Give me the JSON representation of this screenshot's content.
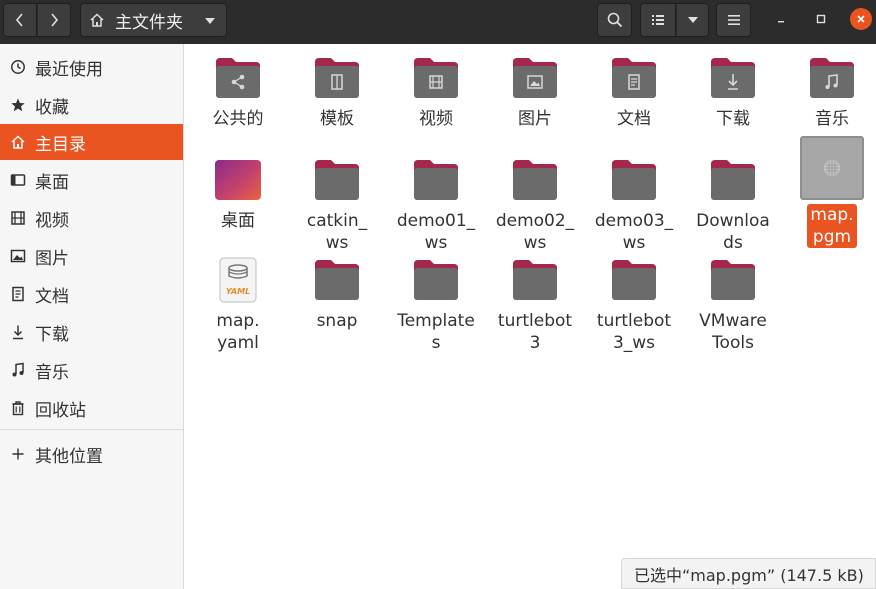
{
  "header": {
    "path_label": "主文件夹"
  },
  "sidebar": {
    "items": [
      {
        "label": "最近使用",
        "icon": "clock-icon"
      },
      {
        "label": "收藏",
        "icon": "star-icon"
      },
      {
        "label": "主目录",
        "icon": "home-icon",
        "active": true
      },
      {
        "label": "桌面",
        "icon": "desktop-icon"
      },
      {
        "label": "视频",
        "icon": "film-icon"
      },
      {
        "label": "图片",
        "icon": "picture-icon"
      },
      {
        "label": "文档",
        "icon": "document-icon"
      },
      {
        "label": "下载",
        "icon": "download-icon"
      },
      {
        "label": "音乐",
        "icon": "music-icon"
      },
      {
        "label": "回收站",
        "icon": "trash-icon"
      },
      {
        "label": "其他位置",
        "icon": "plus-icon"
      }
    ]
  },
  "files": [
    {
      "name": "公共的",
      "icon": "share-folder-icon"
    },
    {
      "name": "模板",
      "icon": "template-folder-icon"
    },
    {
      "name": "视频",
      "icon": "video-folder-icon"
    },
    {
      "name": "图片",
      "icon": "picture-folder-icon"
    },
    {
      "name": "文档",
      "icon": "document-folder-icon"
    },
    {
      "name": "下载",
      "icon": "download-folder-icon"
    },
    {
      "name": "音乐",
      "icon": "music-folder-icon"
    },
    {
      "name": "桌面",
      "icon": "desktop-folder-icon"
    },
    {
      "name": "catkin_\nws",
      "icon": "folder-icon"
    },
    {
      "name": "demo01_\nws",
      "icon": "folder-icon"
    },
    {
      "name": "demo02_\nws",
      "icon": "folder-icon"
    },
    {
      "name": "demo03_\nws",
      "icon": "folder-icon"
    },
    {
      "name": "Downloa\nds",
      "icon": "folder-icon"
    },
    {
      "name": "map.\npgm",
      "icon": "image-file-icon",
      "selected": true
    },
    {
      "name": "map.\nyaml",
      "icon": "yaml-file-icon"
    },
    {
      "name": "snap",
      "icon": "folder-icon"
    },
    {
      "name": "Template\ns",
      "icon": "folder-icon"
    },
    {
      "name": "turtlebot\n3",
      "icon": "folder-icon"
    },
    {
      "name": "turtlebot\n3_ws",
      "icon": "folder-icon"
    },
    {
      "name": "VMware\nTools",
      "icon": "folder-icon"
    }
  ],
  "status": {
    "text": "已选中“map.pgm” (147.5 kB)"
  },
  "colors": {
    "accent": "#e95420",
    "folder_tab": "#a5274b",
    "folder_body": "#6b6b6b"
  }
}
